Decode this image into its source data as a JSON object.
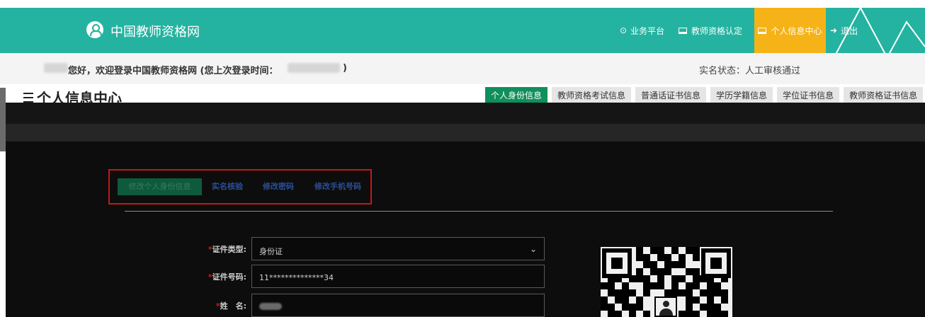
{
  "header": {
    "site_title": "中国教师资格网",
    "nav": [
      {
        "label": "业务平台",
        "icon": "dashboard-icon"
      },
      {
        "label": "教师资格认定",
        "icon": "monitor-icon"
      },
      {
        "label": "个人信息中心",
        "icon": "monitor-icon",
        "active": true
      },
      {
        "label": "退出",
        "icon": "logout-icon"
      }
    ],
    "accent_color": "#24b3a0",
    "active_color": "#f5b318"
  },
  "welcome": {
    "greeting": "您好，欢迎登录中国教师资格网 (您上次登录时间：",
    "close_paren": ")",
    "realname_status": "实名状态：人工审核通过"
  },
  "page": {
    "title": "个人信息中心",
    "tabs": [
      {
        "label": "个人身份信息",
        "active": true
      },
      {
        "label": "教师资格考试信息"
      },
      {
        "label": "普通话证书信息"
      },
      {
        "label": "学历学籍信息"
      },
      {
        "label": "学位证书信息"
      },
      {
        "label": "教师资格证书信息"
      }
    ]
  },
  "subtabs": [
    {
      "label": "修改个人身份信息",
      "active": true
    },
    {
      "label": "实名核验"
    },
    {
      "label": "修改密码"
    },
    {
      "label": "修改手机号码"
    }
  ],
  "form": {
    "id_type": {
      "required_mark": "*",
      "label": "证件类型:",
      "value": "身份证"
    },
    "id_number": {
      "required_mark": "*",
      "label": "证件号码:",
      "value": "11**************34"
    },
    "name": {
      "required_mark": "*",
      "label": "姓　名:"
    }
  }
}
